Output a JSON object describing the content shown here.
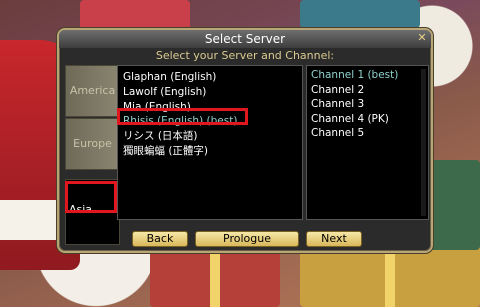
{
  "dialog": {
    "title": "Select Server",
    "subtitle": "Select your Server and Channel:",
    "close_glyph": "✕"
  },
  "regions": [
    {
      "label": "America",
      "selected": false
    },
    {
      "label": "Europe",
      "selected": false
    },
    {
      "label": "Asia",
      "selected": true
    }
  ],
  "servers": [
    {
      "label": "Glaphan (English)",
      "selected": false
    },
    {
      "label": "Lawolf (English)",
      "selected": false
    },
    {
      "label": "Mia (English)",
      "selected": false
    },
    {
      "label": "Rhisis (English) (best)",
      "selected": true
    },
    {
      "label": "リシス (日本語)",
      "selected": false
    },
    {
      "label": "獨眼蝙蝠 (正體字)",
      "selected": false
    }
  ],
  "channels": [
    {
      "label": "Channel 1 (best)",
      "selected": true
    },
    {
      "label": "Channel 2",
      "selected": false
    },
    {
      "label": "Channel 3",
      "selected": false
    },
    {
      "label": "Channel 4 (PK)",
      "selected": false
    },
    {
      "label": "Channel 5",
      "selected": false
    }
  ],
  "buttons": {
    "back": "Back",
    "prologue": "Prologue",
    "next": "Next"
  },
  "colors": {
    "highlight_outline": "#e0171f",
    "selected_text": "#8fd3cf",
    "frame": "#b8a677"
  }
}
